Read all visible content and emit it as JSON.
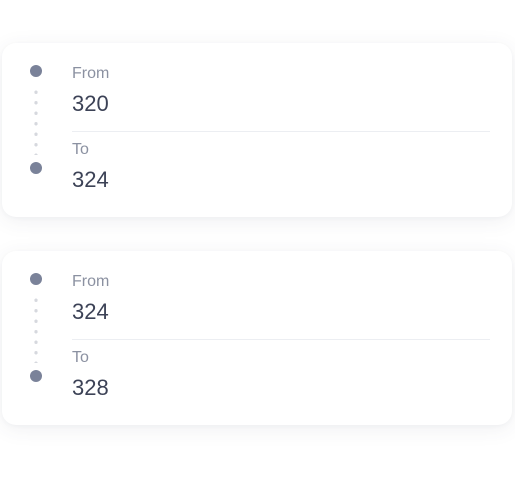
{
  "routes": [
    {
      "from_label": "From",
      "from_value": "320",
      "to_label": "To",
      "to_value": "324"
    },
    {
      "from_label": "From",
      "from_value": "324",
      "to_label": "To",
      "to_value": "328"
    }
  ],
  "colors": {
    "dot": "#7a8299",
    "label": "#8b91a1",
    "value": "#3c4256",
    "divider": "#eceef2"
  }
}
